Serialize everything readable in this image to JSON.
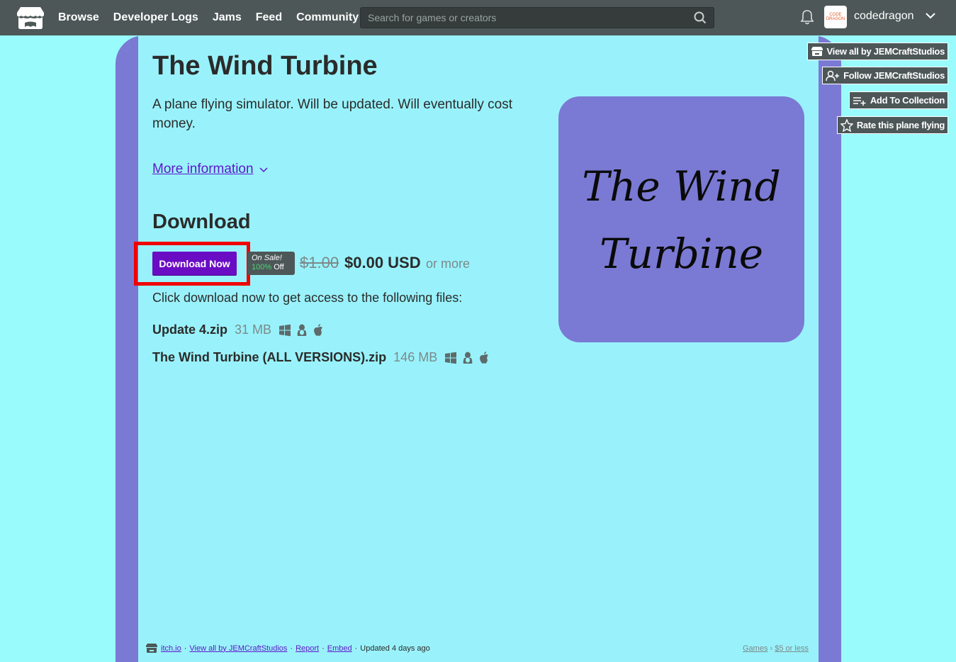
{
  "header": {
    "nav": [
      "Browse",
      "Developer Logs",
      "Jams",
      "Feed",
      "Community"
    ],
    "search_placeholder": "Search for games or creators",
    "avatar_text": "CODE DRAGON",
    "username": "codedragon"
  },
  "game": {
    "title": "The Wind Turbine",
    "description": "A plane flying simulator. Will be updated. Will eventually cost money.",
    "more_info": "More information",
    "download_heading": "Download",
    "download_button": "Download Now",
    "sale_label": "On Sale!",
    "sale_pct": "100%",
    "sale_off": "Off",
    "old_price": "$1.00",
    "new_price": "$0.00 USD",
    "or_more": "or more",
    "click_text": "Click download now to get access to the following files:",
    "files": [
      {
        "name": "Update 4.zip",
        "size": "31 MB"
      },
      {
        "name": "The Wind Turbine (ALL VERSIONS).zip",
        "size": "146 MB"
      }
    ],
    "cover_line1": "The Wind",
    "cover_line2": "Turbine"
  },
  "side_actions": {
    "view_all": "View all by JEMCraftStudios",
    "follow": "Follow JEMCraftStudios",
    "add_collection": "Add To Collection",
    "rate": "Rate this plane flying"
  },
  "footer": {
    "itchio": "itch.io",
    "view_all": "View all by JEMCraftStudios",
    "report": "Report",
    "embed": "Embed",
    "updated": "Updated 4 days ago",
    "games": "Games",
    "price_filter": "$5 or less"
  }
}
